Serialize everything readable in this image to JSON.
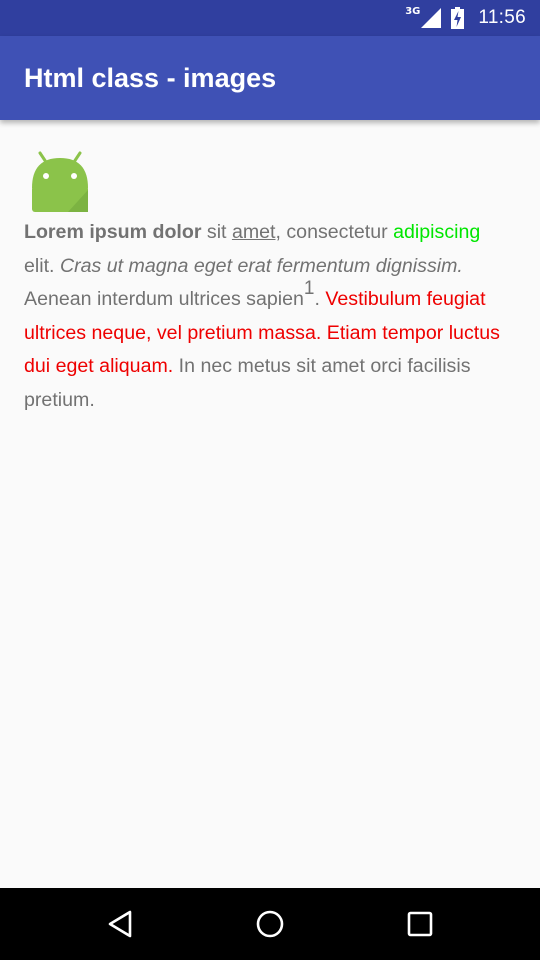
{
  "status_bar": {
    "network_type": "3G",
    "time": "11:56",
    "icons": [
      "signal-icon",
      "battery-charging-icon"
    ]
  },
  "app_bar": {
    "title": "Html class - images"
  },
  "content": {
    "image": "android-robot-icon",
    "text_runs": {
      "bold": "Lorem ipsum dolor",
      "t1": " sit ",
      "underline": "amet",
      "t2": ", consectetur ",
      "green": "adipiscing",
      "t3": " elit. ",
      "italic": "Cras ut magna eget erat fermentum dignissim.",
      "t4": " Aenean interdum ultrices sapien",
      "sup": "1",
      "t5": ". ",
      "red": "Vestibulum feugiat ultrices neque, vel pretium massa. Etiam tempor luctus dui eget aliquam.",
      "t6": " In nec metus sit amet orci facilisis pretium."
    }
  },
  "colors": {
    "status_bar": "#303f9f",
    "app_bar": "#3f51b5",
    "background": "#fafafa",
    "body_text": "#727272",
    "green_text": "#00e600",
    "red_text": "#ee0000",
    "android_green": "#8bc34a"
  },
  "nav_bar": {
    "buttons": [
      "back-icon",
      "home-icon",
      "recents-icon"
    ]
  }
}
